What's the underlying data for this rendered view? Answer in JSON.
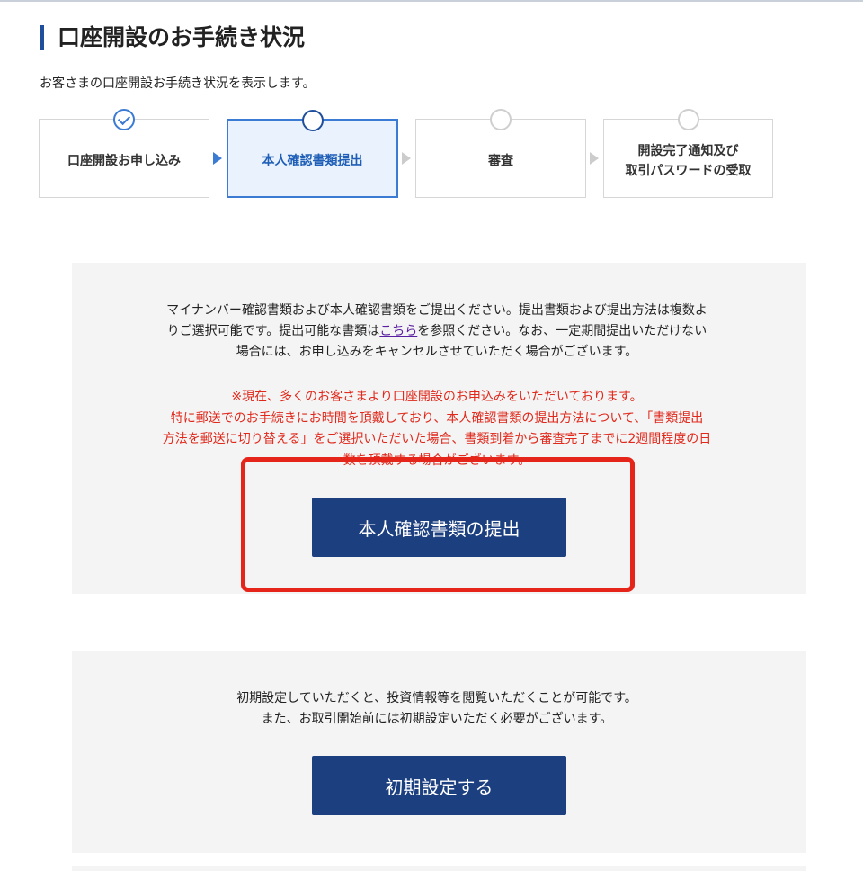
{
  "header": {
    "title": "口座開設のお手続き状況",
    "description": "お客さまの口座開設お手続き状況を表示します。"
  },
  "steps": [
    {
      "label": "口座開設お申し込み",
      "state": "done"
    },
    {
      "label": "本人確認書類提出",
      "state": "current"
    },
    {
      "label": "審査",
      "state": "pending"
    },
    {
      "label": "開設完了通知及び\n取引パスワードの受取",
      "state": "pending"
    }
  ],
  "verification": {
    "notice_before_link": "マイナンバー確認書類および本人確認書類をご提出ください。提出書類および提出方法は複数よ\nりご選択可能です。提出可能な書類は",
    "link_label": "こちら",
    "notice_after_link": "を参照ください。なお、一定期間提出いただけない\n場合には、お申し込みをキャンセルさせていただく場合がございます。",
    "warning": "※現在、多くのお客さまより口座開設のお申込みをいただいております。\n特に郵送でのお手続きにお時間を頂戴しており、本人確認書類の提出方法について、「書類提出\n方法を郵送に切り替える」をご選択いただいた場合、書類到着から審査完了までに2週間程度の日\n数を頂戴する場合がございます。",
    "button_label": "本人確認書類の提出"
  },
  "initial_setup": {
    "description": "初期設定していただくと、投資情報等を閲覧いただくことが可能です。\nまた、お取引開始前には初期設定いただく必要がございます。",
    "button_label": "初期設定する"
  },
  "colors": {
    "brand_blue": "#1c3f80",
    "accent_blue": "#3b7bd4",
    "warning_red": "#e0281b",
    "highlight_red": "#e5241a"
  }
}
